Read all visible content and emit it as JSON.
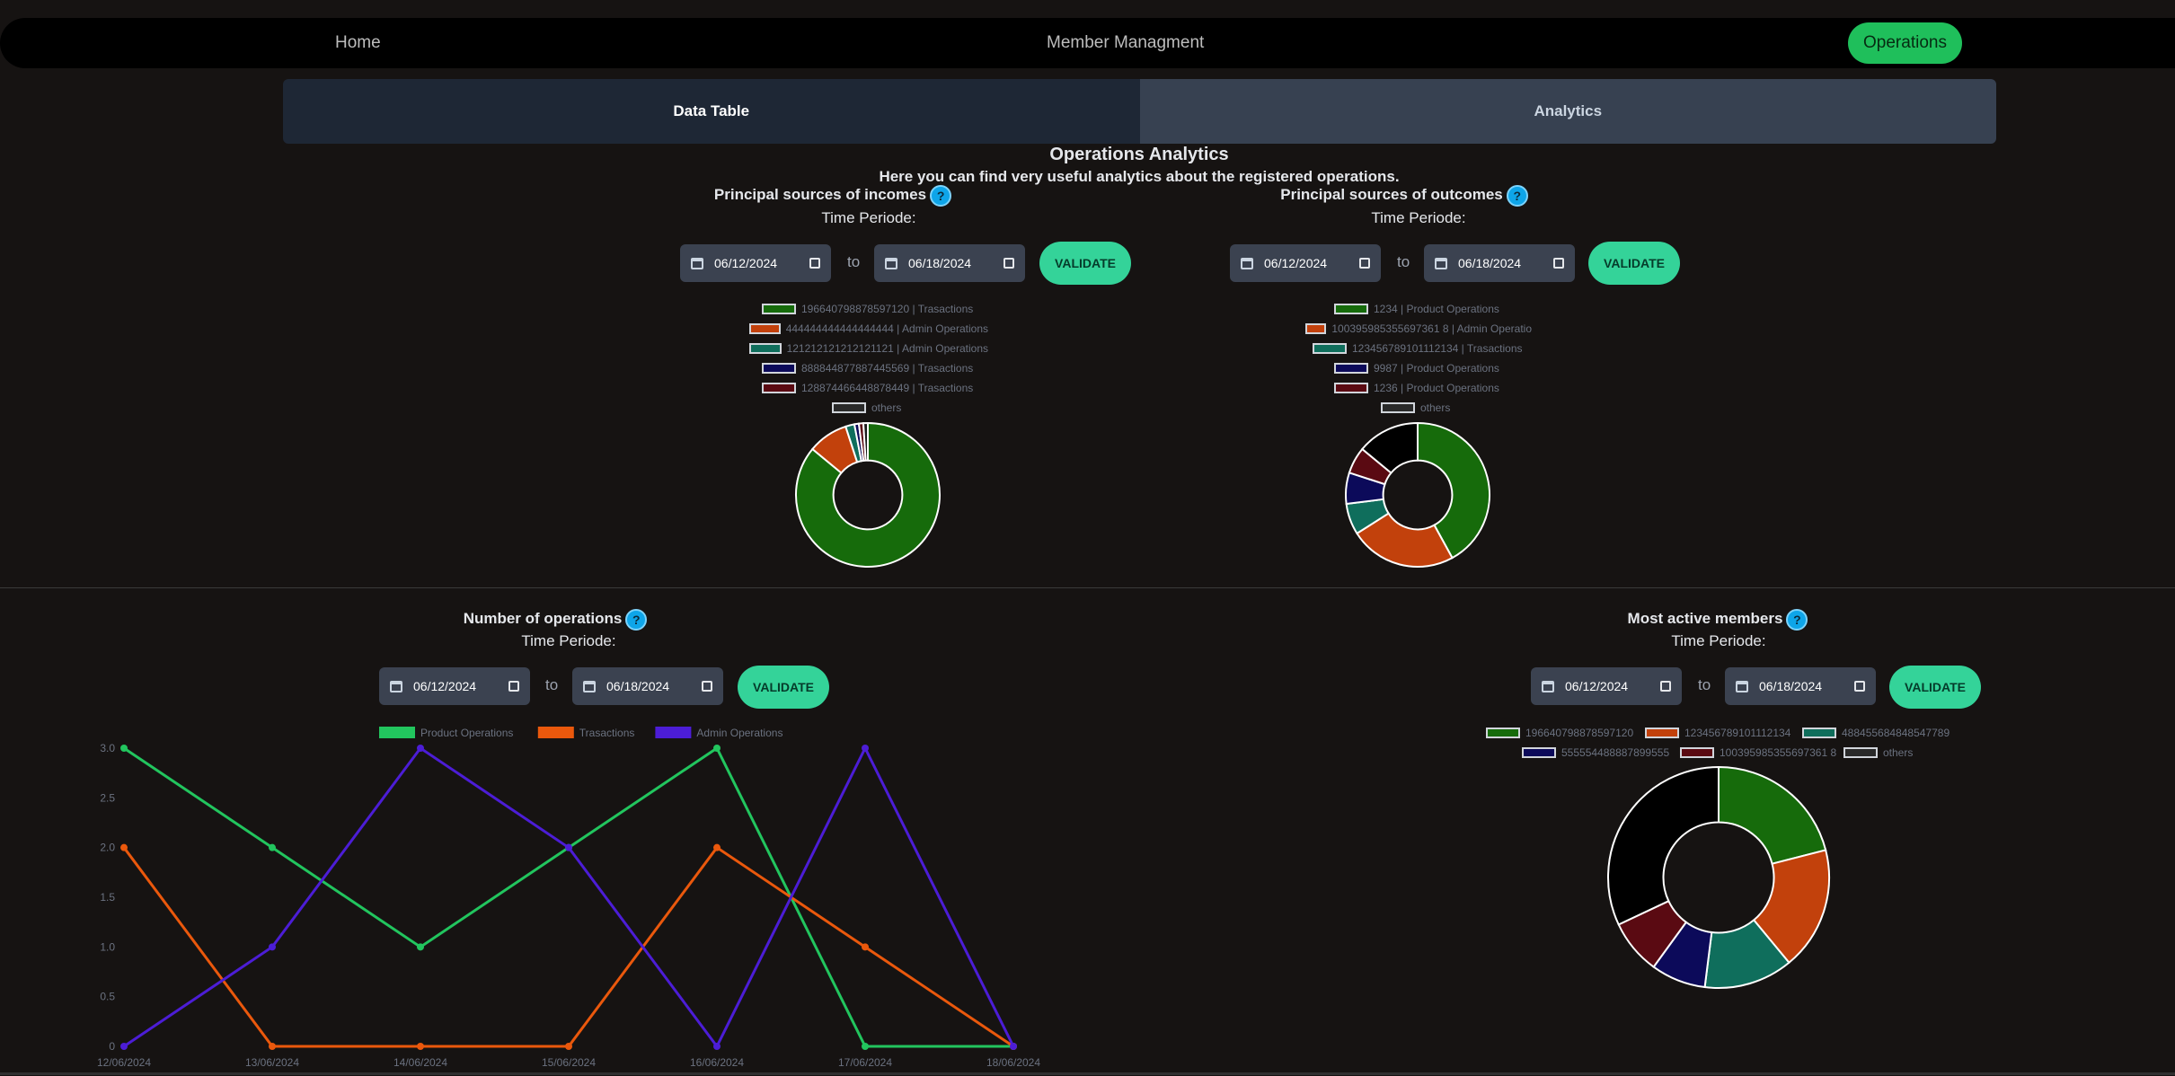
{
  "nav": {
    "home": "Home",
    "members": "Member Managment",
    "operations": "Operations"
  },
  "tabs": {
    "data_table": "Data Table",
    "analytics": "Analytics"
  },
  "page": {
    "title": "Operations Analytics",
    "subtitle": "Here you can find very useful analytics about the registered operations."
  },
  "common": {
    "time_periode": "Time Periode:",
    "to": "to",
    "validate": "VALIDATE",
    "help": "?"
  },
  "incomes": {
    "title": "Principal sources of incomes",
    "from": "06/12/2024",
    "until": "06/18/2024",
    "legend": [
      {
        "label": "196640798878597120 | Trasactions",
        "color": "#166b0b"
      },
      {
        "label": "444444444444444444 | Admin Operations",
        "color": "#c2410c"
      },
      {
        "label": "121212121212121121 | Admin Operations",
        "color": "#0f6e5c"
      },
      {
        "label": "888844877887445569 | Trasactions",
        "color": "#0c0a5a"
      },
      {
        "label": "128874466448878449 | Trasactions",
        "color": "#5a0a12"
      },
      {
        "label": "others",
        "color": "#2a2a2a"
      }
    ],
    "chart_data": {
      "type": "pie",
      "labels": [
        "196640798878597120 | Trasactions",
        "444444444444444444 | Admin Operations",
        "121212121212121121 | Admin Operations",
        "888844877887445569 | Trasactions",
        "128874466448878449 | Trasactions",
        "others"
      ],
      "values": [
        86,
        9,
        2,
        1,
        1,
        1
      ],
      "colors": [
        "#166b0b",
        "#c2410c",
        "#0f6e5c",
        "#0c0a5a",
        "#5a0a12",
        "#1a1a1a"
      ]
    }
  },
  "outcomes": {
    "title": "Principal sources of outcomes",
    "from": "06/12/2024",
    "until": "06/18/2024",
    "legend": [
      {
        "label": "1234 | Product Operations",
        "color": "#166b0b"
      },
      {
        "label": "100395985355697361 8 | Admin Operatio",
        "color": "#c2410c"
      },
      {
        "label": "123456789101112134 | Trasactions",
        "color": "#0f6e5c"
      },
      {
        "label": "9987 | Product Operations",
        "color": "#0c0a5a"
      },
      {
        "label": "1236 | Product Operations",
        "color": "#5a0a12"
      },
      {
        "label": "others",
        "color": "#2a2a2a"
      }
    ],
    "chart_data": {
      "type": "pie",
      "labels": [
        "1234 | Product Operations",
        "100395985355697361 8 | Admin Operatio",
        "123456789101112134 | Trasactions",
        "9987 | Product Operations",
        "1236 | Product Operations",
        "others"
      ],
      "values": [
        42,
        24,
        7,
        7,
        6,
        14
      ],
      "colors": [
        "#166b0b",
        "#c2410c",
        "#0f6e5c",
        "#0c0a5a",
        "#5a0a12",
        "#000000"
      ]
    }
  },
  "operations": {
    "title": "Number of operations",
    "from": "06/12/2024",
    "until": "06/18/2024",
    "chart_data": {
      "type": "line",
      "x": [
        "12/06/2024",
        "13/06/2024",
        "14/06/2024",
        "15/06/2024",
        "16/06/2024",
        "17/06/2024",
        "18/06/2024"
      ],
      "ylim": [
        0,
        3
      ],
      "yticks": [
        "0",
        "0.5",
        "1.0",
        "1.5",
        "2.0",
        "2.5",
        "3.0"
      ],
      "series": [
        {
          "name": "Product Operations",
          "color": "#22c55e",
          "values": [
            3,
            2,
            1,
            2,
            3,
            0,
            0
          ]
        },
        {
          "name": "Trasactions",
          "color": "#ea580c",
          "values": [
            2,
            0,
            0,
            0,
            2,
            1,
            0
          ]
        },
        {
          "name": "Admin Operations",
          "color": "#4c1dd6",
          "values": [
            0,
            1,
            3,
            2,
            0,
            3,
            0
          ]
        }
      ]
    }
  },
  "members": {
    "title": "Most active members",
    "from": "06/12/2024",
    "until": "06/18/2024",
    "legend": [
      {
        "label": "196640798878597120",
        "color": "#166b0b"
      },
      {
        "label": "123456789101112134",
        "color": "#c2410c"
      },
      {
        "label": "488455684848547789",
        "color": "#0f6e5c"
      },
      {
        "label": "555554488887899555",
        "color": "#0c0a5a"
      },
      {
        "label": "100395985355697361 8",
        "color": "#5a0a12"
      },
      {
        "label": "others",
        "color": "#2a2a2a"
      }
    ],
    "chart_data": {
      "type": "pie",
      "labels": [
        "196640798878597120",
        "123456789101112134",
        "488455684848547789",
        "555554488887899555",
        "100395985355697361 8",
        "others"
      ],
      "values": [
        21,
        18,
        13,
        8,
        8,
        32
      ],
      "colors": [
        "#166b0b",
        "#c2410c",
        "#0f6e5c",
        "#0c0a5a",
        "#5a0a12",
        "#000000"
      ]
    }
  }
}
